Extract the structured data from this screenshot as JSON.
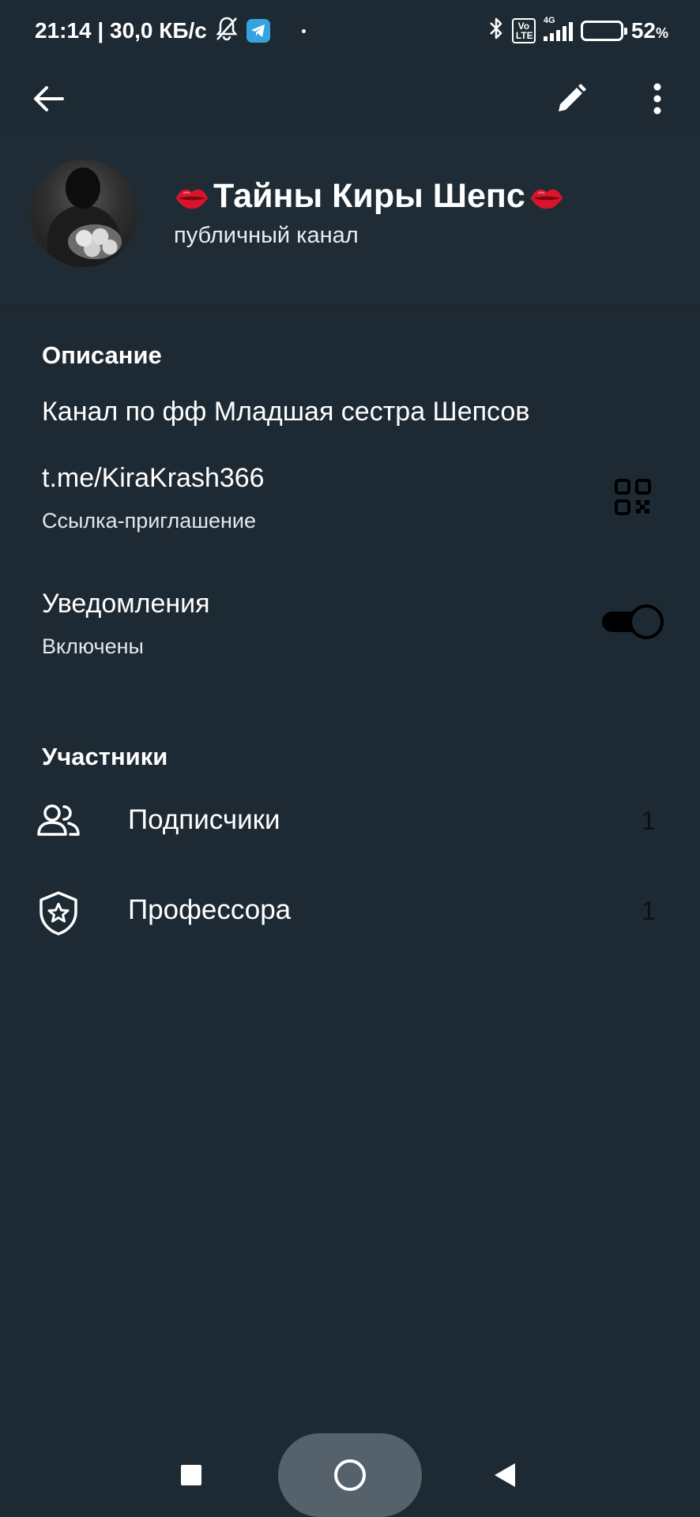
{
  "status_bar": {
    "time_speed": "21:14 | 30,0 КБ/с",
    "network_type": "4G",
    "volte": "Vo LTE",
    "battery_percent": "52",
    "battery_unit": "%",
    "battery_level": 0.52,
    "icons": [
      "bell-off-icon",
      "telegram-icon",
      "bluetooth-icon",
      "volte-icon",
      "signal-icon",
      "battery-icon"
    ]
  },
  "header": {
    "icons": [
      "back-arrow-icon",
      "edit-pencil-icon",
      "more-vertical-icon"
    ]
  },
  "profile": {
    "title": "Тайны Киры Шепс",
    "subtitle": "публичный канал"
  },
  "info": {
    "description_title": "Описание",
    "description_text": "Канал по фф Младшая сестра Шепсов",
    "link": "t.me/KiraKrash366",
    "link_caption": "Ссылка-приглашение",
    "notifications_label": "Уведомления",
    "notifications_state": "Включены",
    "notifications_on": true
  },
  "members": {
    "title": "Участники",
    "rows": [
      {
        "label": "Подписчики",
        "count": "1",
        "icon": "people-icon"
      },
      {
        "label": "Профессора",
        "count": "1",
        "icon": "shield-star-icon"
      }
    ]
  },
  "colors": {
    "background": "#1e2a33",
    "text": "#ffffff",
    "count_text": "#0b1116",
    "battery_fill": "#f2b030",
    "telegram": "#34a3e0"
  }
}
